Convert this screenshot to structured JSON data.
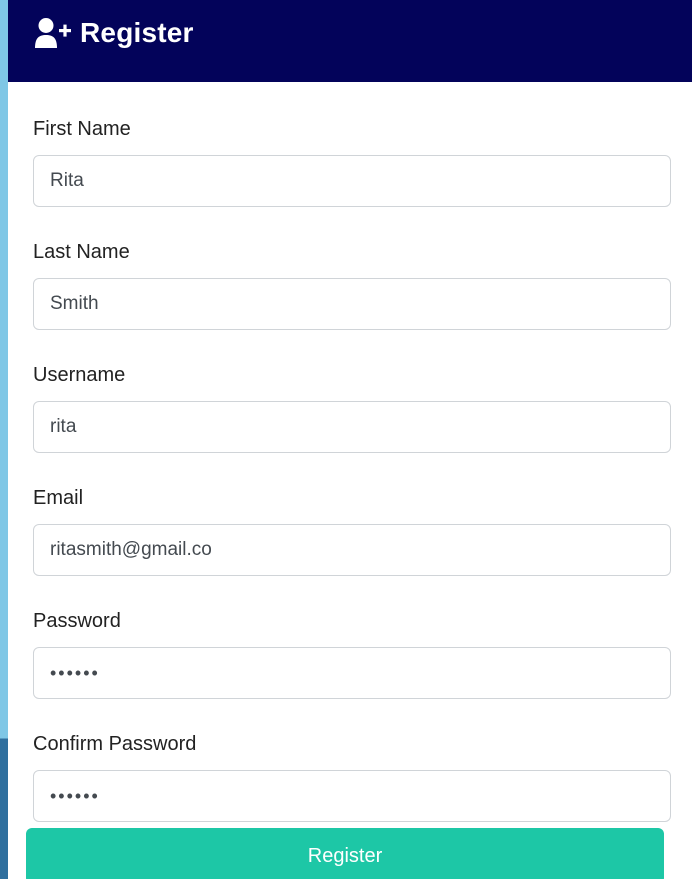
{
  "colors": {
    "header_bg": "#03035a",
    "accent": "#1dc7a6",
    "page_bg": "#b9e2f4"
  },
  "header": {
    "icon": "user-plus-icon",
    "title": "Register"
  },
  "form": {
    "fields": [
      {
        "label": "First Name",
        "value": "Rita"
      },
      {
        "label": "Last Name",
        "value": "Smith"
      },
      {
        "label": "Username",
        "value": "rita"
      },
      {
        "label": "Email",
        "value": "ritasmith@gmail.co"
      },
      {
        "label": "Password",
        "value": "••••••"
      },
      {
        "label": "Confirm Password",
        "value": "••••••"
      }
    ],
    "submit_label": "Register"
  }
}
